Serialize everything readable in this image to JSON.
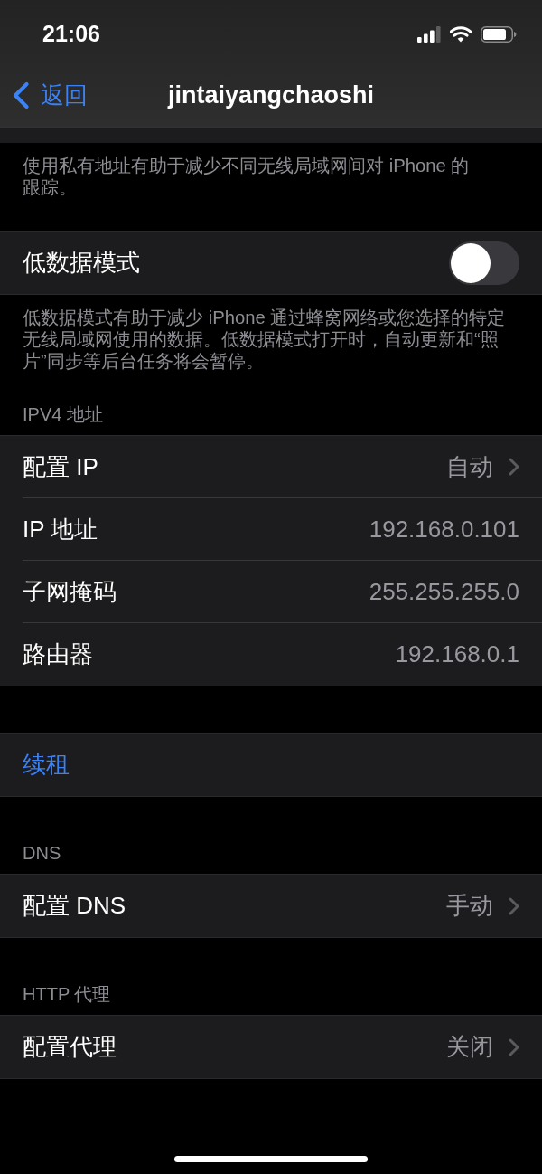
{
  "status_bar": {
    "time": "21:06"
  },
  "nav_bar": {
    "back": "返回",
    "title": "jintaiyangchaoshi"
  },
  "sections": [
    {
      "footer": "使用私有地址有助于减少不同无线局域网间对 iPhone 的跟踪。"
    },
    {
      "rows": [
        {
          "kind": "toggle",
          "label": "低数据模式",
          "on": false
        }
      ],
      "footer": "低数据模式有助于减少 iPhone 通过蜂窝网络或您选择的特定无线局域网使用的数据。低数据模式打开时，自动更新和“照片”同步等后台任务将会暂停。"
    },
    {
      "header": "IPV4 地址",
      "rows": [
        {
          "kind": "disclosure",
          "label": "配置 IP",
          "value": "自动"
        },
        {
          "kind": "value",
          "label": "IP 地址",
          "value": "192.168.0.101"
        },
        {
          "kind": "value",
          "label": "子网掩码",
          "value": "255.255.255.0"
        },
        {
          "kind": "value",
          "label": "路由器",
          "value": "192.168.0.1"
        }
      ]
    },
    {
      "rows": [
        {
          "kind": "action",
          "label": "续租"
        }
      ]
    },
    {
      "header": "DNS",
      "rows": [
        {
          "kind": "disclosure",
          "label": "配置 DNS",
          "value": "手动"
        }
      ]
    },
    {
      "header": "HTTP 代理",
      "rows": [
        {
          "kind": "disclosure",
          "label": "配置代理",
          "value": "关闭"
        }
      ]
    }
  ]
}
